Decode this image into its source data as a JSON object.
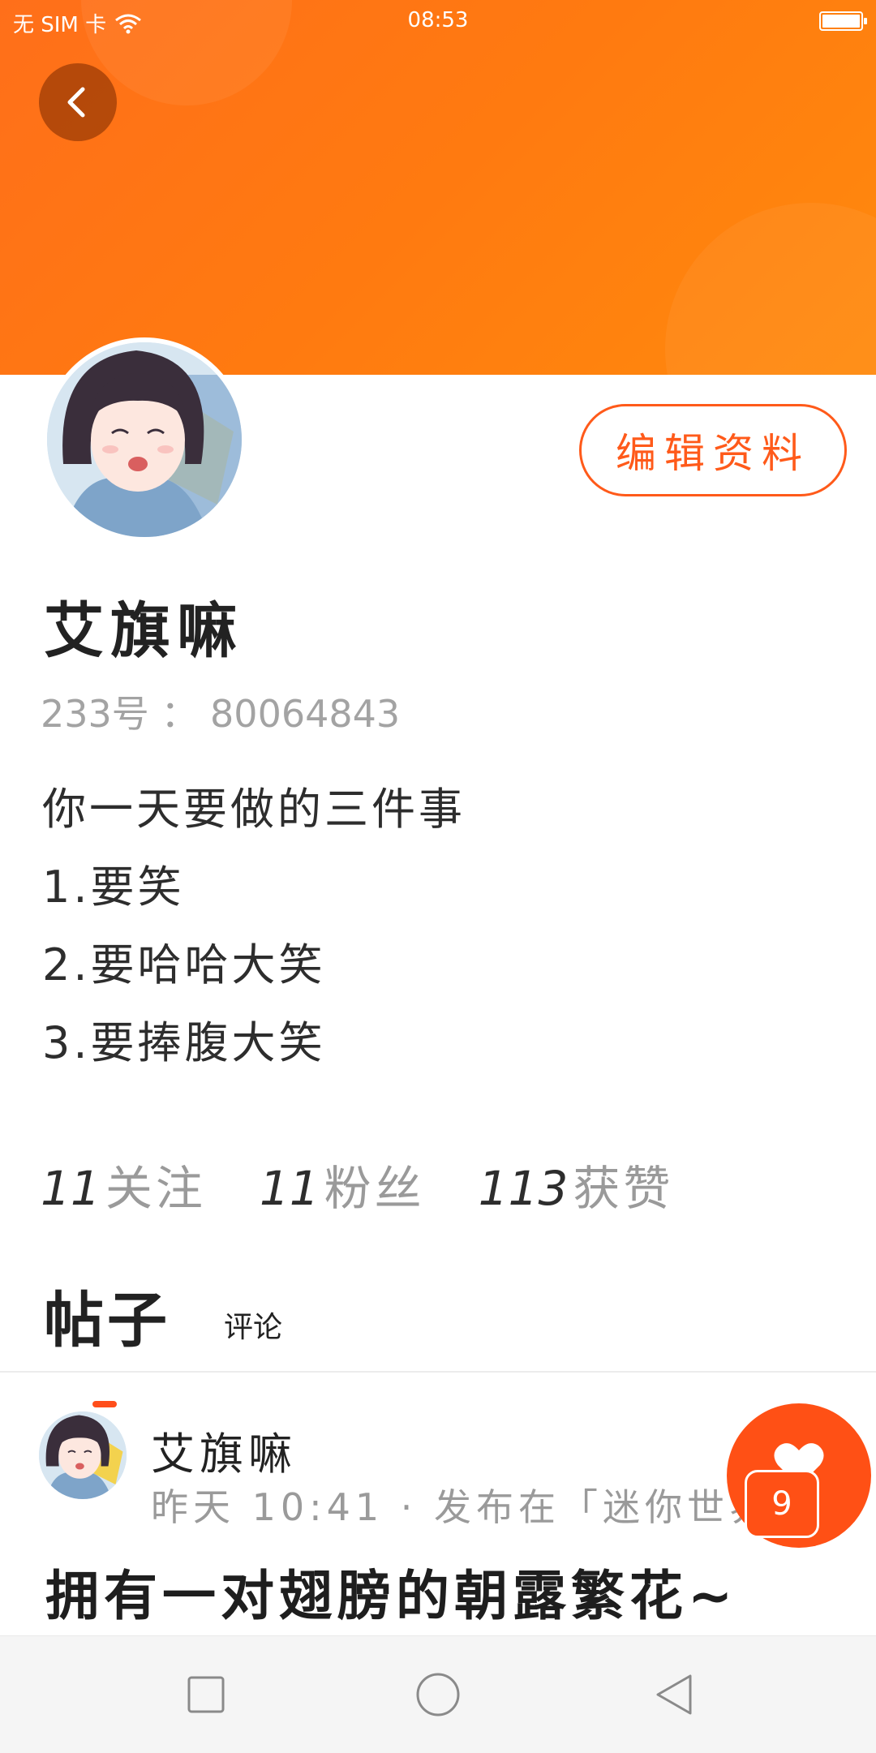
{
  "status_bar": {
    "carrier": "无 SIM 卡",
    "time": "08:53"
  },
  "colors": {
    "accent": "#ff5a1a",
    "header_gradient_start": "#ff6f1a",
    "header_gradient_end": "#ff8a0d"
  },
  "header": {
    "back_icon": "chevron-left-icon"
  },
  "profile": {
    "edit_button_label": "编辑资料",
    "name": "艾旗嘛",
    "id_text": "233号 ： 80064843",
    "bio_lines": [
      "你一天要做的三件事",
      "1.要笑",
      "2.要哈哈大笑",
      "3.要捧腹大笑"
    ]
  },
  "stats": [
    {
      "count": "11",
      "label": "关注"
    },
    {
      "count": "11",
      "label": "粉丝"
    },
    {
      "count": "113",
      "label": "获赞"
    }
  ],
  "tabs": {
    "active": "帖子",
    "other": "评论"
  },
  "post": {
    "author": "艾旗嘛",
    "meta": "昨天 10:41 · 发布在「迷你世界",
    "title": "拥有一对翅膀的朝露繁花~"
  },
  "like_fab": {
    "icon": "heart-icon",
    "count": "9"
  },
  "nav_bar": {
    "icons": [
      "square-recent-icon",
      "circle-home-icon",
      "triangle-back-icon"
    ]
  }
}
